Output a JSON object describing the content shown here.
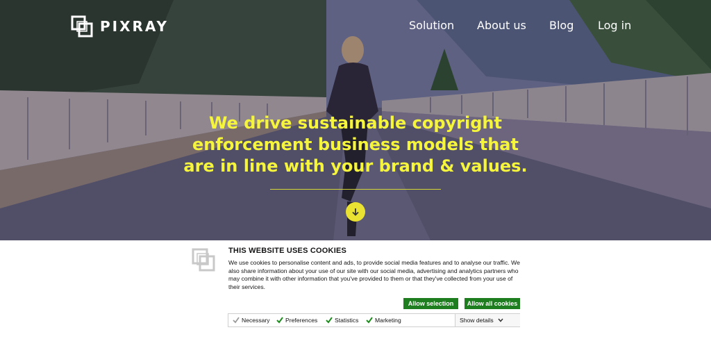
{
  "brand": {
    "name": "PIXRAY",
    "icon": "pixray-logo-icon"
  },
  "nav": {
    "items": [
      "Solution",
      "About us",
      "Blog",
      "Log in"
    ]
  },
  "hero": {
    "headline_lines": [
      "We drive sustainable copyright",
      "enforcement business models that",
      "are in line with your brand & values."
    ],
    "headline_color": "#f5f53d",
    "scroll_icon": "arrow-down-icon"
  },
  "cookie": {
    "title": "THIS WEBSITE USES COOKIES",
    "text": "We use cookies to personalise content and ads, to provide social media features and to analyse our traffic. We also share information about your use of our site with our social media, advertising and analytics partners who may combine it with other information that you've provided to them or that they've collected from your use of their services.",
    "allow_selection": "Allow selection",
    "allow_all": "Allow all cookies",
    "categories": [
      {
        "label": "Necessary",
        "checked": true,
        "locked": true
      },
      {
        "label": "Preferences",
        "checked": true,
        "locked": false
      },
      {
        "label": "Statistics",
        "checked": true,
        "locked": false
      },
      {
        "label": "Marketing",
        "checked": true,
        "locked": false
      }
    ],
    "show_details": "Show details",
    "button_color": "#1e7d1e"
  }
}
